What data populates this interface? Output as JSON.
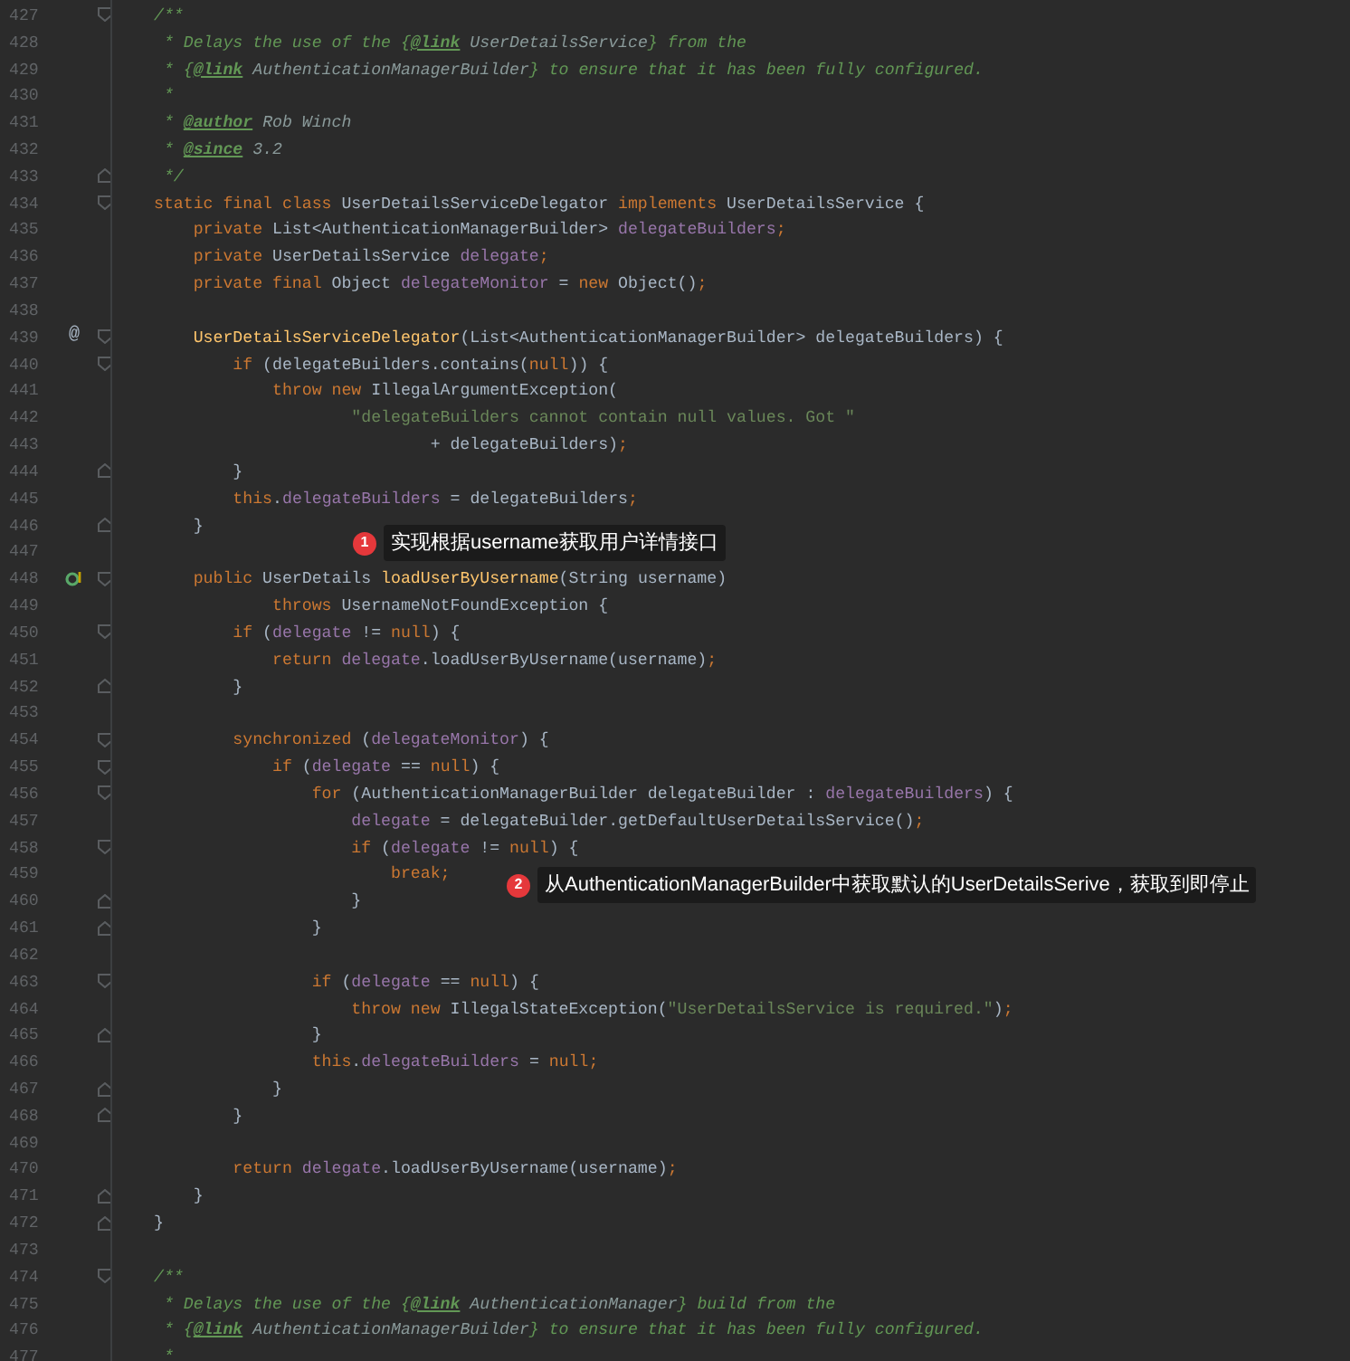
{
  "lines": [
    {
      "number": "427",
      "fold_start": true,
      "segments": [
        {
          "kind": "comment",
          "text": "/**"
        }
      ]
    },
    {
      "number": "428",
      "segments": [
        {
          "kind": "comment",
          "text": " * Delays the use of the {"
        },
        {
          "kind": "doctag",
          "text": "@link"
        },
        {
          "kind": "docref",
          "text": " UserDetailsService"
        },
        {
          "kind": "comment",
          "text": "} from the"
        }
      ]
    },
    {
      "number": "429",
      "segments": [
        {
          "kind": "comment",
          "text": " * {"
        },
        {
          "kind": "doctag",
          "text": "@link"
        },
        {
          "kind": "docref",
          "text": " AuthenticationManagerBuilder"
        },
        {
          "kind": "comment",
          "text": "} to ensure that it has been fully configured."
        }
      ]
    },
    {
      "number": "430",
      "segments": [
        {
          "kind": "comment",
          "text": " *"
        }
      ]
    },
    {
      "number": "431",
      "segments": [
        {
          "kind": "comment",
          "text": " * "
        },
        {
          "kind": "doctag",
          "text": "@author"
        },
        {
          "kind": "docref",
          "text": " Rob Winch"
        }
      ]
    },
    {
      "number": "432",
      "segments": [
        {
          "kind": "comment",
          "text": " * "
        },
        {
          "kind": "doctag",
          "text": "@since"
        },
        {
          "kind": "docref",
          "text": " 3.2"
        }
      ]
    },
    {
      "number": "433",
      "fold_end": true,
      "segments": [
        {
          "kind": "comment",
          "text": " */"
        }
      ]
    },
    {
      "number": "434",
      "fold_start": true,
      "segments": [
        {
          "kind": "keyword",
          "text": "static final class "
        },
        {
          "kind": "plain",
          "text": "UserDetailsServiceDelegator "
        },
        {
          "kind": "keyword",
          "text": "implements "
        },
        {
          "kind": "plain",
          "text": "UserDetailsService {"
        }
      ]
    },
    {
      "number": "435",
      "segments": [
        {
          "kind": "keyword",
          "text": "    private "
        },
        {
          "kind": "plain",
          "text": "List<AuthenticationManagerBuilder> "
        },
        {
          "kind": "field",
          "text": "delegateBuilders"
        },
        {
          "kind": "keyword",
          "text": ";"
        }
      ]
    },
    {
      "number": "436",
      "segments": [
        {
          "kind": "keyword",
          "text": "    private "
        },
        {
          "kind": "plain",
          "text": "UserDetailsService "
        },
        {
          "kind": "field",
          "text": "delegate"
        },
        {
          "kind": "keyword",
          "text": ";"
        }
      ]
    },
    {
      "number": "437",
      "segments": [
        {
          "kind": "keyword",
          "text": "    private final "
        },
        {
          "kind": "plain",
          "text": "Object "
        },
        {
          "kind": "field",
          "text": "delegateMonitor"
        },
        {
          "kind": "plain",
          "text": " = "
        },
        {
          "kind": "keyword",
          "text": "new "
        },
        {
          "kind": "plain",
          "text": "Object()"
        },
        {
          "kind": "keyword",
          "text": ";"
        }
      ]
    },
    {
      "number": "438"
    },
    {
      "number": "439",
      "gutter_mark": "@",
      "fold_start": true,
      "segments": [
        {
          "kind": "method",
          "text": "    UserDetailsServiceDelegator"
        },
        {
          "kind": "plain",
          "text": "(List<AuthenticationManagerBuilder> delegateBuilders) {"
        }
      ]
    },
    {
      "number": "440",
      "fold_start": true,
      "segments": [
        {
          "kind": "keyword",
          "text": "        if "
        },
        {
          "kind": "plain",
          "text": "(delegateBuilders.contains("
        },
        {
          "kind": "keyword",
          "text": "null"
        },
        {
          "kind": "plain",
          "text": ")) {"
        }
      ]
    },
    {
      "number": "441",
      "segments": [
        {
          "kind": "keyword",
          "text": "            throw new "
        },
        {
          "kind": "plain",
          "text": "IllegalArgumentException("
        }
      ]
    },
    {
      "number": "442",
      "segments": [
        {
          "kind": "string",
          "text": "                    \"delegateBuilders cannot contain null values. Got \""
        }
      ]
    },
    {
      "number": "443",
      "segments": [
        {
          "kind": "plain",
          "text": "                            + delegateBuilders)"
        },
        {
          "kind": "keyword",
          "text": ";"
        }
      ]
    },
    {
      "number": "444",
      "fold_end": true,
      "segments": [
        {
          "kind": "plain",
          "text": "        }"
        }
      ]
    },
    {
      "number": "445",
      "segments": [
        {
          "kind": "keyword",
          "text": "        this"
        },
        {
          "kind": "plain",
          "text": "."
        },
        {
          "kind": "field",
          "text": "delegateBuilders"
        },
        {
          "kind": "plain",
          "text": " = delegateBuilders"
        },
        {
          "kind": "keyword",
          "text": ";"
        }
      ]
    },
    {
      "number": "446",
      "fold_end": true,
      "segments": [
        {
          "kind": "plain",
          "text": "    }"
        }
      ]
    },
    {
      "number": "447"
    },
    {
      "number": "448",
      "overrides": true,
      "fold_start": true,
      "segments": [
        {
          "kind": "keyword",
          "text": "    public "
        },
        {
          "kind": "plain",
          "text": "UserDetails "
        },
        {
          "kind": "method",
          "text": "loadUserByUsername"
        },
        {
          "kind": "plain",
          "text": "(String username)"
        }
      ]
    },
    {
      "number": "449",
      "segments": [
        {
          "kind": "keyword",
          "text": "            throws "
        },
        {
          "kind": "plain",
          "text": "UsernameNotFoundException {"
        }
      ]
    },
    {
      "number": "450",
      "fold_start": true,
      "segments": [
        {
          "kind": "keyword",
          "text": "        if "
        },
        {
          "kind": "plain",
          "text": "("
        },
        {
          "kind": "field",
          "text": "delegate"
        },
        {
          "kind": "plain",
          "text": " != "
        },
        {
          "kind": "keyword",
          "text": "null"
        },
        {
          "kind": "plain",
          "text": ") {"
        }
      ]
    },
    {
      "number": "451",
      "segments": [
        {
          "kind": "keyword",
          "text": "            return "
        },
        {
          "kind": "field",
          "text": "delegate"
        },
        {
          "kind": "plain",
          "text": ".loadUserByUsername(username)"
        },
        {
          "kind": "keyword",
          "text": ";"
        }
      ]
    },
    {
      "number": "452",
      "fold_end": true,
      "segments": [
        {
          "kind": "plain",
          "text": "        }"
        }
      ]
    },
    {
      "number": "453"
    },
    {
      "number": "454",
      "fold_start": true,
      "segments": [
        {
          "kind": "keyword",
          "text": "        synchronized "
        },
        {
          "kind": "plain",
          "text": "("
        },
        {
          "kind": "field",
          "text": "delegateMonitor"
        },
        {
          "kind": "plain",
          "text": ") {"
        }
      ]
    },
    {
      "number": "455",
      "fold_start": true,
      "segments": [
        {
          "kind": "keyword",
          "text": "            if "
        },
        {
          "kind": "plain",
          "text": "("
        },
        {
          "kind": "field",
          "text": "delegate"
        },
        {
          "kind": "plain",
          "text": " == "
        },
        {
          "kind": "keyword",
          "text": "null"
        },
        {
          "kind": "plain",
          "text": ") {"
        }
      ]
    },
    {
      "number": "456",
      "fold_start": true,
      "segments": [
        {
          "kind": "keyword",
          "text": "                for "
        },
        {
          "kind": "plain",
          "text": "(AuthenticationManagerBuilder delegateBuilder : "
        },
        {
          "kind": "field",
          "text": "delegateBuilders"
        },
        {
          "kind": "plain",
          "text": ") {"
        }
      ]
    },
    {
      "number": "457",
      "segments": [
        {
          "kind": "field",
          "text": "                    delegate"
        },
        {
          "kind": "plain",
          "text": " = delegateBuilder.getDefaultUserDetailsService()"
        },
        {
          "kind": "keyword",
          "text": ";"
        }
      ]
    },
    {
      "number": "458",
      "fold_start": true,
      "segments": [
        {
          "kind": "keyword",
          "text": "                    if "
        },
        {
          "kind": "plain",
          "text": "("
        },
        {
          "kind": "field",
          "text": "delegate"
        },
        {
          "kind": "plain",
          "text": " != "
        },
        {
          "kind": "keyword",
          "text": "null"
        },
        {
          "kind": "plain",
          "text": ") {"
        }
      ]
    },
    {
      "number": "459",
      "segments": [
        {
          "kind": "keyword",
          "text": "                        break;"
        }
      ]
    },
    {
      "number": "460",
      "fold_end": true,
      "segments": [
        {
          "kind": "plain",
          "text": "                    }"
        }
      ]
    },
    {
      "number": "461",
      "fold_end": true,
      "segments": [
        {
          "kind": "plain",
          "text": "                }"
        }
      ]
    },
    {
      "number": "462"
    },
    {
      "number": "463",
      "fold_start": true,
      "segments": [
        {
          "kind": "keyword",
          "text": "                if "
        },
        {
          "kind": "plain",
          "text": "("
        },
        {
          "kind": "field",
          "text": "delegate"
        },
        {
          "kind": "plain",
          "text": " == "
        },
        {
          "kind": "keyword",
          "text": "null"
        },
        {
          "kind": "plain",
          "text": ") {"
        }
      ]
    },
    {
      "number": "464",
      "segments": [
        {
          "kind": "keyword",
          "text": "                    throw new "
        },
        {
          "kind": "plain",
          "text": "IllegalStateException("
        },
        {
          "kind": "string",
          "text": "\"UserDetailsService is required.\""
        },
        {
          "kind": "plain",
          "text": ")"
        },
        {
          "kind": "keyword",
          "text": ";"
        }
      ]
    },
    {
      "number": "465",
      "fold_end": true,
      "segments": [
        {
          "kind": "plain",
          "text": "                }"
        }
      ]
    },
    {
      "number": "466",
      "segments": [
        {
          "kind": "keyword",
          "text": "                this"
        },
        {
          "kind": "plain",
          "text": "."
        },
        {
          "kind": "field",
          "text": "delegateBuilders"
        },
        {
          "kind": "plain",
          "text": " = "
        },
        {
          "kind": "keyword",
          "text": "null;"
        }
      ]
    },
    {
      "number": "467",
      "fold_end": true,
      "segments": [
        {
          "kind": "plain",
          "text": "            }"
        }
      ]
    },
    {
      "number": "468",
      "fold_end": true,
      "segments": [
        {
          "kind": "plain",
          "text": "        }"
        }
      ]
    },
    {
      "number": "469"
    },
    {
      "number": "470",
      "segments": [
        {
          "kind": "keyword",
          "text": "        return "
        },
        {
          "kind": "field",
          "text": "delegate"
        },
        {
          "kind": "plain",
          "text": ".loadUserByUsername(username)"
        },
        {
          "kind": "keyword",
          "text": ";"
        }
      ]
    },
    {
      "number": "471",
      "fold_end": true,
      "segments": [
        {
          "kind": "plain",
          "text": "    }"
        }
      ]
    },
    {
      "number": "472",
      "fold_end": true,
      "segments": [
        {
          "kind": "plain",
          "text": "}"
        }
      ]
    },
    {
      "number": "473"
    },
    {
      "number": "474",
      "fold_start": true,
      "segments": [
        {
          "kind": "comment",
          "text": "/**"
        }
      ]
    },
    {
      "number": "475",
      "segments": [
        {
          "kind": "comment",
          "text": " * Delays the use of the {"
        },
        {
          "kind": "doctag",
          "text": "@link"
        },
        {
          "kind": "docref",
          "text": " AuthenticationManager"
        },
        {
          "kind": "comment",
          "text": "} build from the"
        }
      ]
    },
    {
      "number": "476",
      "segments": [
        {
          "kind": "comment",
          "text": " * {"
        },
        {
          "kind": "doctag",
          "text": "@link"
        },
        {
          "kind": "docref",
          "text": " AuthenticationManagerBuilder"
        },
        {
          "kind": "comment",
          "text": "} to ensure that it has been fully configured."
        }
      ]
    },
    {
      "number": "477",
      "segments": [
        {
          "kind": "comment",
          "text": " *"
        }
      ]
    }
  ],
  "callouts": [
    {
      "number": "1",
      "text": "实现根据username获取用户详情接口"
    },
    {
      "number": "2",
      "text": "从AuthenticationManagerBuilder中获取默认的UserDetailsSerive，获取到即停止"
    }
  ]
}
